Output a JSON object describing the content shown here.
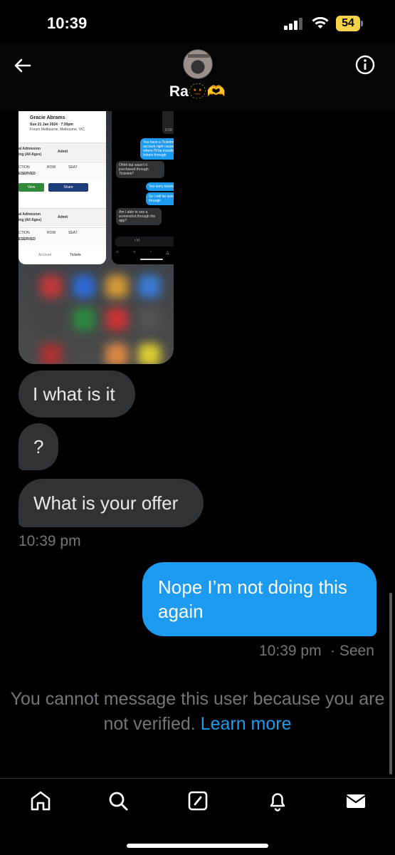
{
  "status_bar": {
    "time": "10:39",
    "battery_level": "54",
    "battery_color": "#f4d34a"
  },
  "header": {
    "back_icon": "arrow-left-icon",
    "contact_name": "Ra🫥🫶",
    "info_icon": "info-circle-icon"
  },
  "shared_image": {
    "ticket": {
      "artist": "Gracie Abrams",
      "date": "Sun 21 Jan 2024 · 7:30pm",
      "venue": "Forum Melbourne, Melbourne, VIC",
      "section1_label": "al Admission",
      "section1_sub": "ing (All Ages)",
      "admit": "Admit",
      "col_section": "CTION",
      "col_row": "ROW",
      "col_seat": "SEAT",
      "reserved": "ESERVED",
      "view_btn": "View",
      "share_btn": "Share",
      "section2_label": "al Admission",
      "section2_sub": "ing (All Ages)",
      "tab_account": "Account",
      "tab_tickets": "Tickets"
    },
    "mini_chat": {
      "thumb_time": "0:15",
      "msg1": "You have a Ticketmaster account right cause that's where I'll be transferring the tickets through",
      "msg2": "Ohhh but wasn't it purchased through Ticketek?",
      "msg3": "Yes sorry tickete",
      "msg4": "So I will be sending it through",
      "msg5": "Am I able to see a screenshot through the app?",
      "composer_placeholder": "f M"
    }
  },
  "messages": {
    "incoming": [
      {
        "text": "I what is it"
      },
      {
        "text": "?"
      },
      {
        "text": "What is your offer"
      }
    ],
    "incoming_time": "10:39 pm",
    "outgoing": [
      {
        "text": "Nope I’m not doing this again"
      }
    ],
    "outgoing_time": "10:39 pm",
    "outgoing_status": "· Seen",
    "accent_color": "#1d9bf0"
  },
  "notice": {
    "text": "You cannot message this user because you are not verified.",
    "link": "Learn more"
  },
  "bottom_nav": {
    "items": [
      {
        "icon": "home-icon"
      },
      {
        "icon": "search-icon"
      },
      {
        "icon": "compose-icon"
      },
      {
        "icon": "bell-icon"
      },
      {
        "icon": "mail-icon"
      }
    ]
  }
}
